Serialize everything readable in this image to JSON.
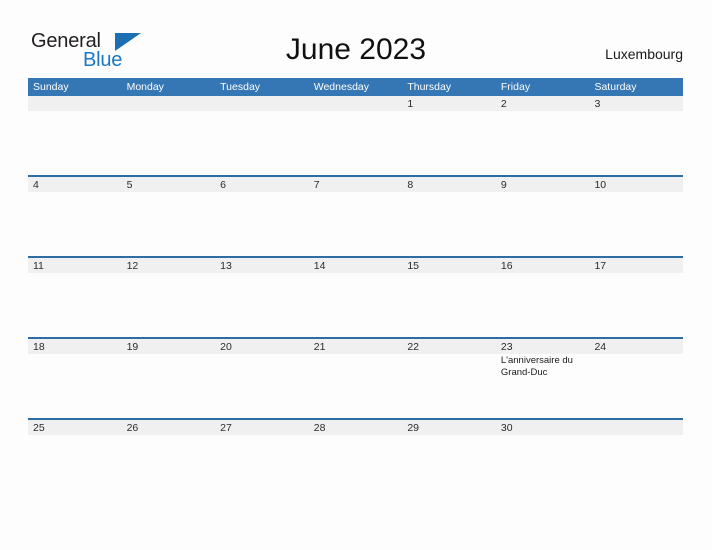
{
  "brand": {
    "name_part1": "General",
    "name_part2": "Blue",
    "accent_color": "#1c78c0",
    "triangle_color": "#1c6fb0"
  },
  "header": {
    "title": "June 2023",
    "region": "Luxembourg"
  },
  "calendar": {
    "month": "June",
    "year": "2023",
    "header_bg": "#3576b5",
    "row_divider_color": "#2e6da4",
    "day_band_color": "#f0f0f0",
    "day_names": [
      "Sunday",
      "Monday",
      "Tuesday",
      "Wednesday",
      "Thursday",
      "Friday",
      "Saturday"
    ],
    "weeks": [
      [
        {
          "num": "",
          "events": []
        },
        {
          "num": "",
          "events": []
        },
        {
          "num": "",
          "events": []
        },
        {
          "num": "",
          "events": []
        },
        {
          "num": "1",
          "events": []
        },
        {
          "num": "2",
          "events": []
        },
        {
          "num": "3",
          "events": []
        }
      ],
      [
        {
          "num": "4",
          "events": []
        },
        {
          "num": "5",
          "events": []
        },
        {
          "num": "6",
          "events": []
        },
        {
          "num": "7",
          "events": []
        },
        {
          "num": "8",
          "events": []
        },
        {
          "num": "9",
          "events": []
        },
        {
          "num": "10",
          "events": []
        }
      ],
      [
        {
          "num": "11",
          "events": []
        },
        {
          "num": "12",
          "events": []
        },
        {
          "num": "13",
          "events": []
        },
        {
          "num": "14",
          "events": []
        },
        {
          "num": "15",
          "events": []
        },
        {
          "num": "16",
          "events": []
        },
        {
          "num": "17",
          "events": []
        }
      ],
      [
        {
          "num": "18",
          "events": []
        },
        {
          "num": "19",
          "events": []
        },
        {
          "num": "20",
          "events": []
        },
        {
          "num": "21",
          "events": []
        },
        {
          "num": "22",
          "events": []
        },
        {
          "num": "23",
          "events": [
            "L'anniversaire du Grand-Duc"
          ]
        },
        {
          "num": "24",
          "events": []
        }
      ],
      [
        {
          "num": "25",
          "events": []
        },
        {
          "num": "26",
          "events": []
        },
        {
          "num": "27",
          "events": []
        },
        {
          "num": "28",
          "events": []
        },
        {
          "num": "29",
          "events": []
        },
        {
          "num": "30",
          "events": []
        },
        {
          "num": "",
          "events": []
        }
      ]
    ]
  }
}
